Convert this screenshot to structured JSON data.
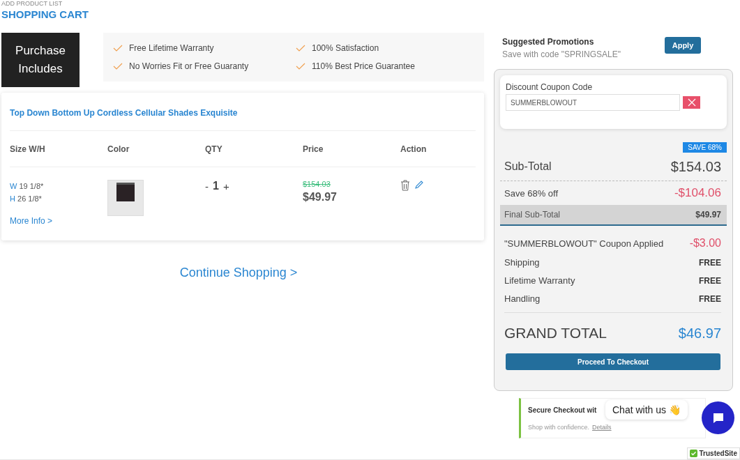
{
  "breadcrumb": "ADD PRODUCT LIST",
  "title": "SHOPPING CART",
  "includes": {
    "heading": "Purchase Includes",
    "items": [
      "Free Lifetime Warranty",
      "100% Satisfaction",
      "No Worries Fit or Free Guaranty",
      "110% Best Price Guarantee"
    ]
  },
  "product": {
    "name": "Top Down Bottom Up Cordless Cellular Shades Exquisite",
    "columns": [
      "Size W/H",
      "Color",
      "QTY",
      "Price",
      "Action"
    ],
    "width_label": "W",
    "width": "19 1/8*",
    "height_label": "H",
    "height": "26 1/8*",
    "more_info": "More Info >",
    "qty_minus": "-",
    "qty": "1",
    "qty_plus": "+",
    "old_price": "$154.03",
    "price": "$49.97"
  },
  "continue": "Continue Shopping >",
  "promo": {
    "title": "Suggested Promotions",
    "subtitle": "Save with code \"SPRINGSALE\"",
    "button": "Apply"
  },
  "coupon": {
    "label": "Discount Coupon Code",
    "value": "SUMMERBLOWOUT"
  },
  "summary": {
    "badge": "SAVE 68%",
    "subtotal_label": "Sub-Total",
    "subtotal": "$154.03",
    "save_label": "Save 68% off",
    "save": "-$104.06",
    "final_label": "Final Sub-Total",
    "final": "$49.97",
    "lines": [
      {
        "label": "\"SUMMERBLOWOUT\" Coupon Applied",
        "value": "-$3.00",
        "kind": "discount"
      },
      {
        "label": "Shipping",
        "value": "FREE",
        "kind": "free"
      },
      {
        "label": "Lifetime Warranty",
        "value": "FREE",
        "kind": "free"
      },
      {
        "label": "Handling",
        "value": "FREE",
        "kind": "free"
      }
    ],
    "grand_label": "GRAND TOTAL",
    "grand": "$46.97",
    "checkout": "Proceed To Checkout"
  },
  "secure": {
    "title": "Secure Checkout wit",
    "note": "Shop with confidence.",
    "link": "Details"
  },
  "chat": "Chat with us 👋",
  "trusted": "TrustedSite"
}
